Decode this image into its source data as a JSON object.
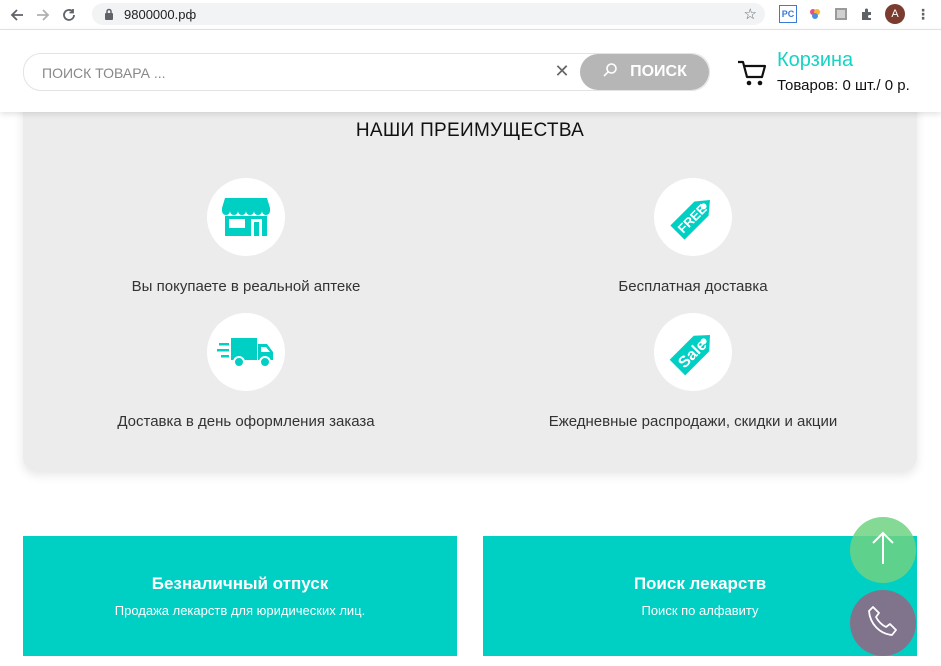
{
  "browser": {
    "url": "9800000.рф",
    "profile_initial": "A",
    "extensions": [
      "pc-extension-icon",
      "colorful-extension-icon",
      "image-extension-icon",
      "puzzle-icon"
    ]
  },
  "header": {
    "search": {
      "placeholder": "ПОИСК ТОВАРА ...",
      "value": "",
      "clear_label": "✕",
      "button_label": "ПОИСК"
    },
    "cart": {
      "title": "Корзина",
      "summary": "Товаров: 0 шт./ 0 р."
    }
  },
  "advantages": {
    "title": "НАШИ ПРЕИМУЩЕСТВА",
    "items": [
      {
        "icon": "store-icon",
        "label": "Вы покупаете в реальной аптеке"
      },
      {
        "icon": "free-tag-icon",
        "label": "Бесплатная доставка"
      },
      {
        "icon": "delivery-truck-icon",
        "label": "Доставка в день оформления заказа"
      },
      {
        "icon": "sale-tag-icon",
        "label": "Ежедневные распродажи, скидки и акции"
      }
    ],
    "free_tag_text": "FREE",
    "sale_tag_text": "Sale"
  },
  "tiles": [
    {
      "title": "Безналичный отпуск",
      "subtitle": "Продажа лекарств для юридических лиц."
    },
    {
      "title": "Поиск лекарств",
      "subtitle": "Поиск по алфавиту"
    }
  ],
  "colors": {
    "accent": "#15d3c5",
    "tile": "#00cfc4",
    "panel": "#ececec",
    "search_button": "#b6b6b6"
  }
}
